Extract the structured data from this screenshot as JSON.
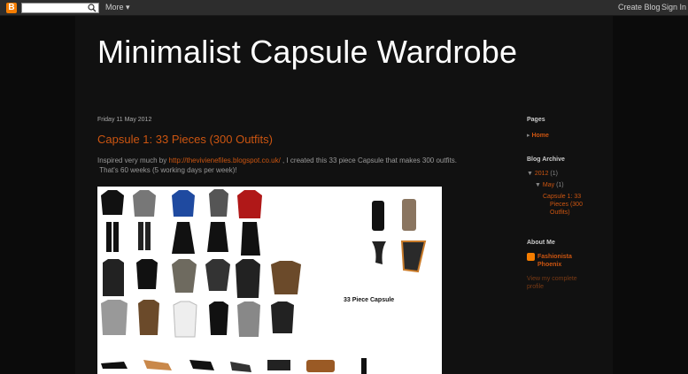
{
  "navbar": {
    "logo_letter": "B",
    "more_label": "More",
    "create_blog": "Create Blog",
    "sign_in": "Sign In"
  },
  "blog": {
    "title": "Minimalist Capsule Wardrobe"
  },
  "post": {
    "date": "Friday 11 May 2012",
    "title": "Capsule 1: 33 Pieces (300 Outfits)",
    "body_intro": "Inspired very much by",
    "body_link": "http://thevivienefiles.blogspot.co.uk/",
    "body_rest": ", I created this 33 piece Capsule that makes 300 outfits.",
    "body_line2": "That's 60 weeks (5 working days per week)!",
    "image_caption": "33 Piece Capsule"
  },
  "sidebar": {
    "pages_heading": "Pages",
    "pages_item": "Home",
    "archive_heading": "Blog Archive",
    "archive_year": "2012",
    "archive_year_count": "(1)",
    "archive_month": "May",
    "archive_month_count": "(1)",
    "archive_post_line1": "Capsule 1: 33",
    "archive_post_line2": "Pieces (300",
    "archive_post_line3": "Outfits)",
    "about_heading": "About Me",
    "profile_name_line1": "Fashionista",
    "profile_name_line2": "Phoenix",
    "profile_link_line1": "View my complete",
    "profile_link_line2": "profile"
  },
  "colors": {
    "accent": "#cc5511",
    "background": "#0b0b0b",
    "navbar": "#2d2d2d",
    "blogger_orange": "#f57d00"
  },
  "icons": [
    "blogger-logo-icon",
    "search-icon",
    "chevron-down-icon",
    "triangle-down-icon",
    "profile-icon"
  ]
}
